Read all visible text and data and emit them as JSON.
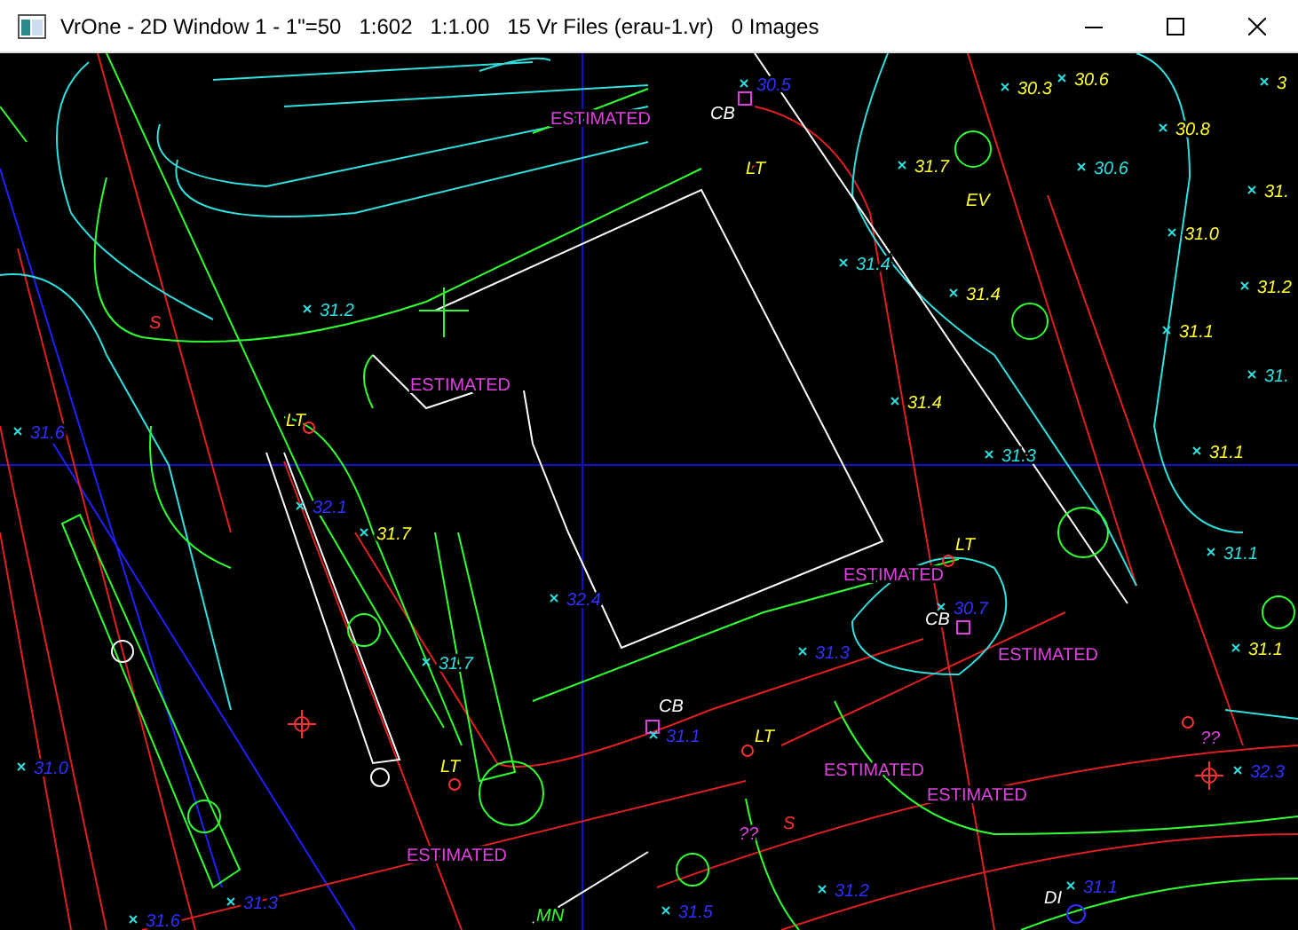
{
  "window": {
    "title": "VrOne - 2D Window 1 - 1\"=50   1:602   1:1.00   15 Vr Files (erau-1.vr)   0 Images"
  },
  "map_labels": [
    {
      "text": "ESTIMATED",
      "color": "#e040e0"
    },
    {
      "text": "30.5",
      "color": "#3030ff"
    },
    {
      "text": "30.3",
      "color": "#ffff30"
    },
    {
      "text": "30.6",
      "color": "#ffff30"
    },
    {
      "text": "3",
      "color": "#ffff30"
    },
    {
      "text": "CB",
      "color": "#ffffff"
    },
    {
      "text": "30.8",
      "color": "#ffff30"
    },
    {
      "text": "LT",
      "color": "#ffff30"
    },
    {
      "text": "31.7",
      "color": "#ffff30"
    },
    {
      "text": "30.6",
      "color": "#30e0e0"
    },
    {
      "text": "EV",
      "color": "#ffff30"
    },
    {
      "text": "31.",
      "color": "#ffff30"
    },
    {
      "text": "31.0",
      "color": "#ffff30"
    },
    {
      "text": "31.4",
      "color": "#30e0e0"
    },
    {
      "text": "31.2",
      "color": "#ffff30"
    },
    {
      "text": "31.4",
      "color": "#ffff30"
    },
    {
      "text": "31.2",
      "color": "#30e0e0"
    },
    {
      "text": "S",
      "color": "#ff3030"
    },
    {
      "text": "31.1",
      "color": "#ffff30"
    },
    {
      "text": "ESTIMATED",
      "color": "#e040e0"
    },
    {
      "text": "31.",
      "color": "#30e0e0"
    },
    {
      "text": "31.4",
      "color": "#ffff30"
    },
    {
      "text": "LT",
      "color": "#ffff30"
    },
    {
      "text": "31.6",
      "color": "#3030ff"
    },
    {
      "text": "31.3",
      "color": "#30e0e0"
    },
    {
      "text": "31.1",
      "color": "#ffff30"
    },
    {
      "text": "32.1",
      "color": "#3030ff"
    },
    {
      "text": "31.7",
      "color": "#ffff30"
    },
    {
      "text": "LT",
      "color": "#ffff30"
    },
    {
      "text": "31.1",
      "color": "#30e0e0"
    },
    {
      "text": "ESTIMATED",
      "color": "#e040e0"
    },
    {
      "text": "32.4",
      "color": "#3030ff"
    },
    {
      "text": "30.7",
      "color": "#3030ff"
    },
    {
      "text": "CB",
      "color": "#ffffff"
    },
    {
      "text": "31.3",
      "color": "#3030ff"
    },
    {
      "text": "ESTIMATED",
      "color": "#e040e0"
    },
    {
      "text": "31.1",
      "color": "#ffff30"
    },
    {
      "text": "31.7",
      "color": "#30e0e0"
    },
    {
      "text": "CB",
      "color": "#ffffff"
    },
    {
      "text": "31.1",
      "color": "#3030ff"
    },
    {
      "text": "LT",
      "color": "#ffff30"
    },
    {
      "text": "??",
      "color": "#e040e0"
    },
    {
      "text": "31.0",
      "color": "#3030ff"
    },
    {
      "text": "LT",
      "color": "#ffff30"
    },
    {
      "text": "ESTIMATED",
      "color": "#e040e0"
    },
    {
      "text": "32.3",
      "color": "#3030ff"
    },
    {
      "text": "ESTIMATED",
      "color": "#e040e0"
    },
    {
      "text": "S",
      "color": "#ff3030"
    },
    {
      "text": "??",
      "color": "#e040e0"
    },
    {
      "text": "ESTIMATED",
      "color": "#e040e0"
    },
    {
      "text": "31.2",
      "color": "#3030ff"
    },
    {
      "text": "DI",
      "color": "#ffffff"
    },
    {
      "text": "31.1",
      "color": "#3030ff"
    },
    {
      "text": "31.3",
      "color": "#3030ff"
    },
    {
      "text": "31.5",
      "color": "#3030ff"
    },
    {
      "text": "MN",
      "color": "#30ff30"
    },
    {
      "text": "31.6",
      "color": "#3030ff"
    }
  ]
}
